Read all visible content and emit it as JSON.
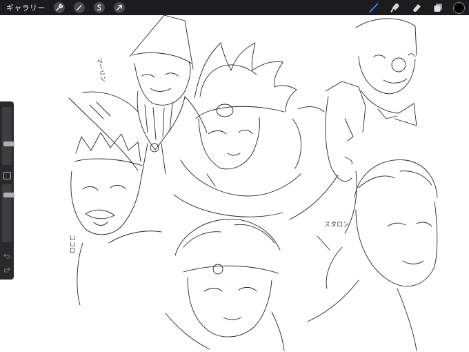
{
  "toolbar": {
    "gallery_label": "ギャラリー",
    "left_tools": [
      {
        "name": "wrench-icon"
      },
      {
        "name": "magic-wand-icon"
      },
      {
        "name": "selection-s-icon"
      },
      {
        "name": "transform-arrow-icon"
      }
    ],
    "right_tools": [
      {
        "name": "brush-icon",
        "active": true
      },
      {
        "name": "smudge-icon"
      },
      {
        "name": "eraser-icon"
      },
      {
        "name": "layers-icon"
      }
    ],
    "current_color": "#000000",
    "accent_color": "#2f7cf6"
  },
  "sidebar": {
    "brush_size_level": 0.35,
    "opacity_level": 0.85
  },
  "canvas": {
    "annotations": {
      "merlin": "マーリン",
      "sutaron": "スタロン",
      "kokoro": "ココロ"
    }
  }
}
